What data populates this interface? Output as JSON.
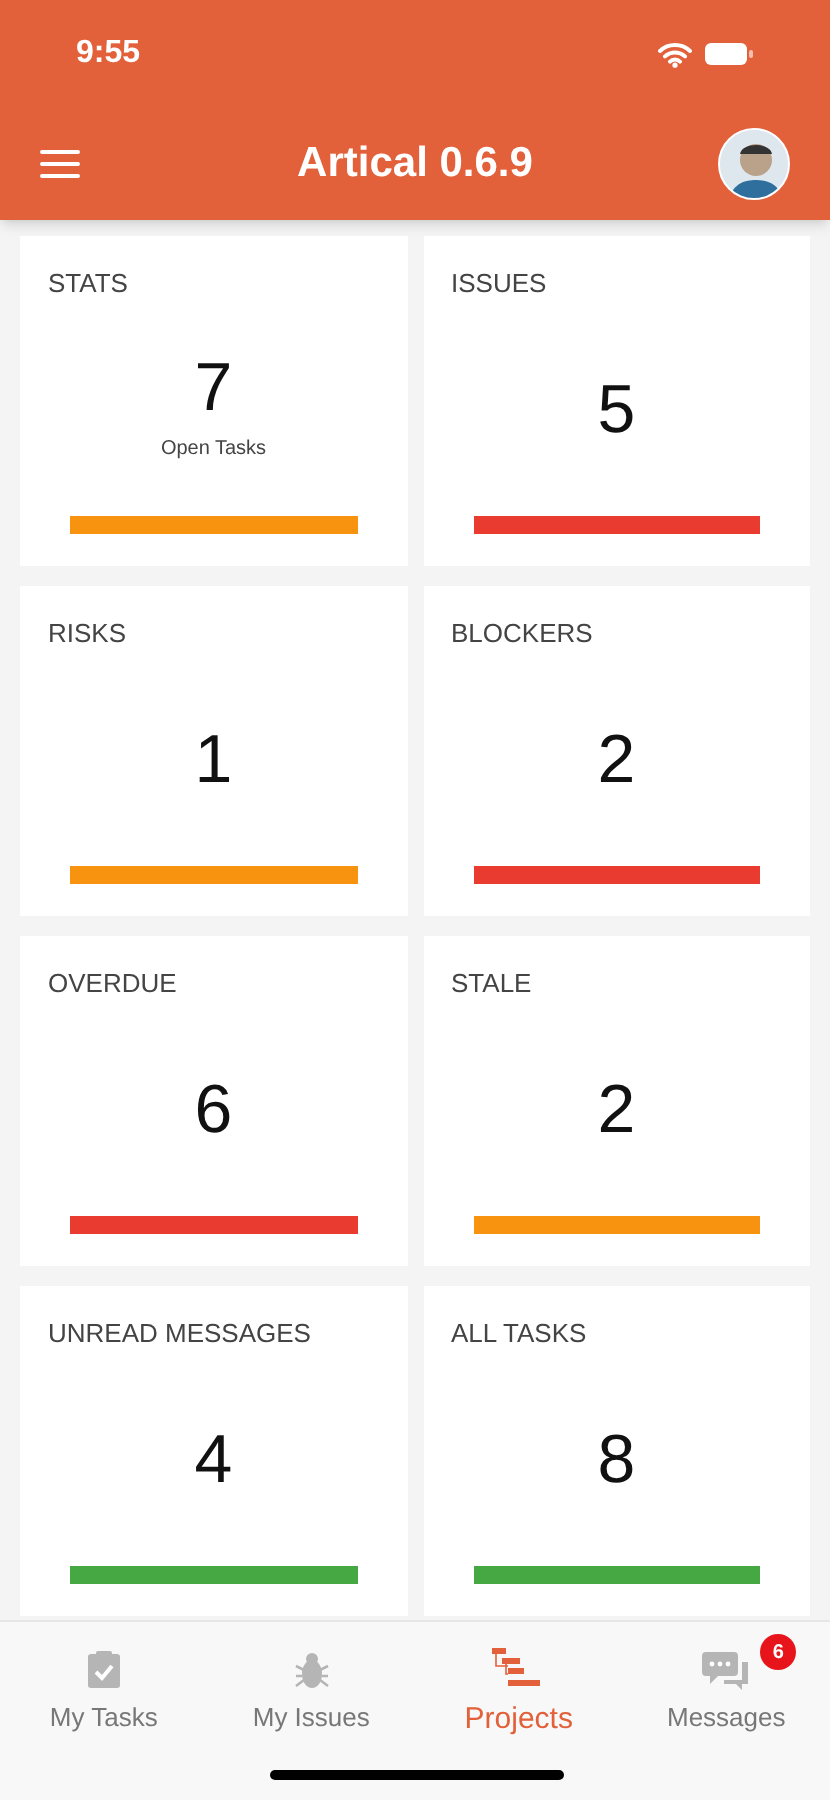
{
  "status_bar": {
    "time": "9:55"
  },
  "header": {
    "title": "Artical 0.6.9"
  },
  "cards": [
    {
      "title": "STATS",
      "value": "7",
      "caption": "Open Tasks",
      "color": "#f7930f"
    },
    {
      "title": "ISSUES",
      "value": "5",
      "color": "#ea3b30"
    },
    {
      "title": "RISKS",
      "value": "1",
      "color": "#f7930f"
    },
    {
      "title": "BLOCKERS",
      "value": "2",
      "color": "#ea3b30"
    },
    {
      "title": "OVERDUE",
      "value": "6",
      "color": "#ea3b30"
    },
    {
      "title": "STALE",
      "value": "2",
      "color": "#f7930f"
    },
    {
      "title": "UNREAD MESSAGES",
      "value": "4",
      "color": "#45a843"
    },
    {
      "title": "ALL TASKS",
      "value": "8",
      "color": "#45a843"
    }
  ],
  "tabs": [
    {
      "kind": "tasks",
      "label": "My Tasks",
      "selected": false
    },
    {
      "kind": "issues",
      "label": "My Issues",
      "selected": false
    },
    {
      "kind": "projects",
      "label": "Projects",
      "selected": true
    },
    {
      "kind": "messages",
      "label": "Messages",
      "selected": false,
      "badge": "6"
    }
  ]
}
